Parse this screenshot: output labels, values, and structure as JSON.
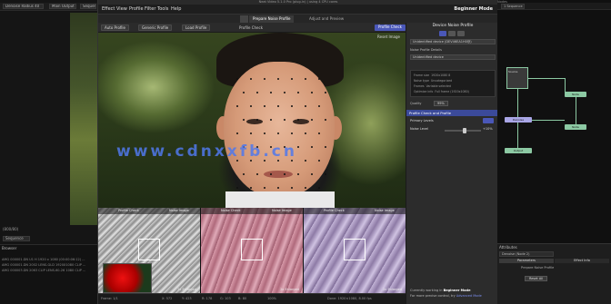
{
  "host": {
    "dropdown_1": "Denoise Radius 40",
    "dropdown_2": "Main Output",
    "dropdown_3": "Sequence",
    "side_info": "(800/80)",
    "mini_field": "Sequence",
    "panel_title": "Browser",
    "rows": [
      "AMG 000001.DN U1 H 1920 x 1080 (00:00:06:12) ...",
      "AMG 000001.DN 2002 LENS-GLD 1920X1080 CLIP ...",
      "AMG 000003.DN 2063 CLIP LENS-60-26 1080 CLIP ..."
    ]
  },
  "plugin": {
    "window_title": "Neat Video 5.1.0 Pro (plug-in) | using 4 CPU cores",
    "menu": [
      "Effect",
      "View",
      "Profile",
      "Filter",
      "Tools",
      "Help"
    ],
    "mode": "Beginner Mode",
    "tabs": [
      "Prepare Noise Profile",
      "Adjust and Preview"
    ],
    "toolbar": {
      "auto_profile": "Auto Profile",
      "generic_profile": "Generic Profile",
      "load_profile": "Load Profile",
      "profile_check_label": "Profile Check",
      "profile_check_btn": "Profile Check",
      "reset_image": "Reset Image"
    },
    "watermark": "www.cdnxxfb.cn",
    "zooms": [
      {
        "left": "Profile Check",
        "right": "Noise Image",
        "foot": "2x Enlarged"
      },
      {
        "left": "Noise Check",
        "right": "Noise Image",
        "foot": "2x Enlarged"
      },
      {
        "left": "Profile Check",
        "right": "Noise Image",
        "foot": "2x Enlarged"
      }
    ],
    "status": {
      "left": "Frame: 1/1",
      "mid1": "X: 572",
      "mid2": "Y: 423",
      "mid3": "R: 178",
      "mid4": "G: 103",
      "mid5": "B: 80",
      "zoom": "100%",
      "right": "Done: 1920×1080, 8.00 fps"
    },
    "right_panel": {
      "title": "Device Noise Profile",
      "profile_select_label": "Unidentified device (DEV46EA1H0@)",
      "meta_label": "Noise Profile Details",
      "meta_select": "Unidentified device",
      "info_rows": [
        {
          "k": "Frame size",
          "v": "1920x1080 8"
        },
        {
          "k": "Noise type",
          "v": "Uncategorized"
        },
        {
          "k": "Frames",
          "v": "Variable selected"
        },
        {
          "k": "Optimize info",
          "v": "Full frame (1920x1080)"
        }
      ],
      "quality_label": "Quality",
      "quality_value": "99%",
      "section": "Profile Check and Profile",
      "primary_label": "Primary Levels",
      "noise_label": "Noise Level",
      "noise_value": "+10%",
      "footer_1": "Currently working in",
      "footer_1b": "Beginner Mode",
      "footer_2": "For more precise control, try",
      "footer_2b": "Advanced Mode"
    }
  },
  "nodes": {
    "title": "Nodes",
    "dropdown": "1 Sequence",
    "labels": [
      "Source",
      "Node",
      "Denoise",
      "Node",
      "Output"
    ]
  },
  "props": {
    "title": "Attributes",
    "search": "Denoise (Node 2)",
    "tabs": [
      "Parameters",
      "Effect Info"
    ],
    "line1": "Prepare Noise Profile",
    "line2": "Reset All"
  },
  "colors": {
    "accent": "#4a57b8",
    "node_green": "#8cc9a3",
    "node_purple": "#a9a6e6"
  }
}
